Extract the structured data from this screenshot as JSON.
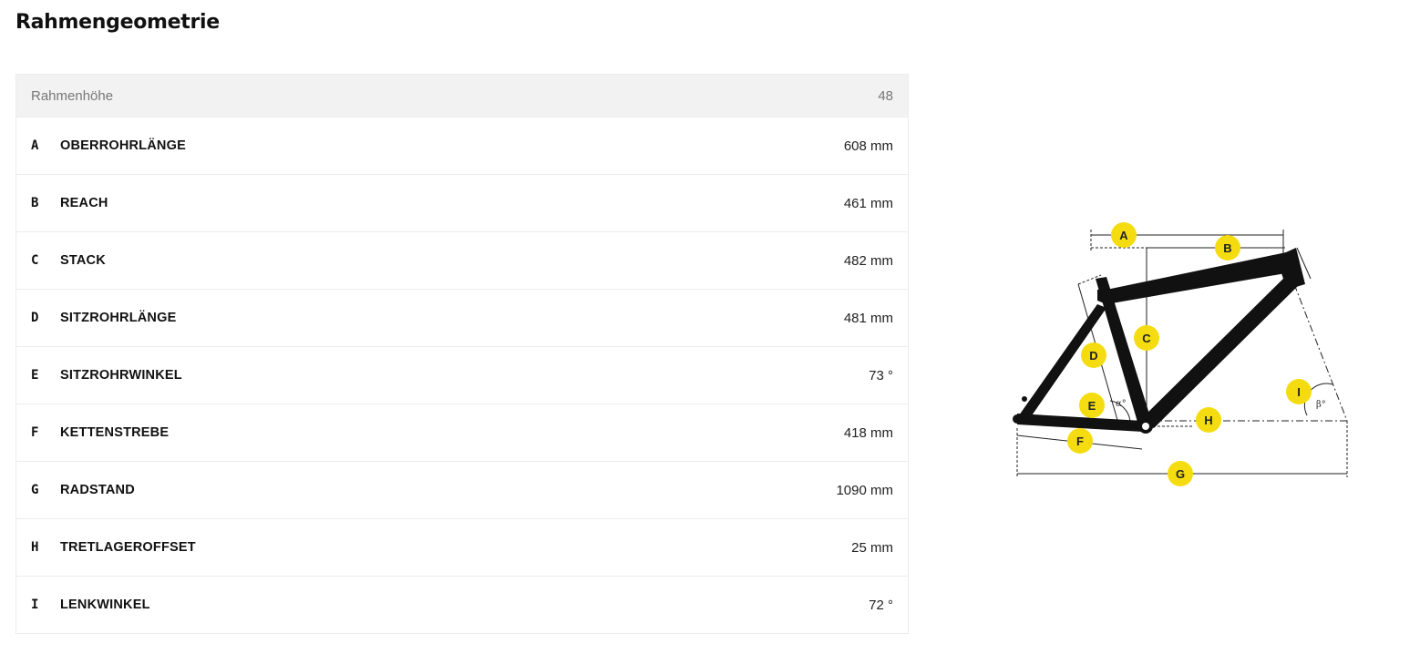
{
  "page": {
    "title": "Rahmengeometrie"
  },
  "table": {
    "header_label": "Rahmenhöhe",
    "header_size": "48",
    "rows": [
      {
        "letter": "A",
        "label": "OBERROHRLÄNGE",
        "value": "608 mm"
      },
      {
        "letter": "B",
        "label": "REACH",
        "value": "461 mm"
      },
      {
        "letter": "C",
        "label": "STACK",
        "value": "482 mm"
      },
      {
        "letter": "D",
        "label": "SITZROHRLÄNGE",
        "value": "481 mm"
      },
      {
        "letter": "E",
        "label": "SITZROHRWINKEL",
        "value": "73 °"
      },
      {
        "letter": "F",
        "label": "KETTENSTREBE",
        "value": "418 mm"
      },
      {
        "letter": "G",
        "label": "RADSTAND",
        "value": "1090 mm"
      },
      {
        "letter": "H",
        "label": "TRETLAGEROFFSET",
        "value": "25 mm"
      },
      {
        "letter": "I",
        "label": "LENKWINKEL",
        "value": "72 °"
      }
    ]
  },
  "diagram": {
    "badge_color": "#f5dc10",
    "frame_color": "#111111",
    "badges": {
      "A": "A",
      "B": "B",
      "C": "C",
      "D": "D",
      "E": "E",
      "F": "F",
      "G": "G",
      "H": "H",
      "I": "I"
    },
    "alpha_label": "α°",
    "beta_label": "β°"
  }
}
